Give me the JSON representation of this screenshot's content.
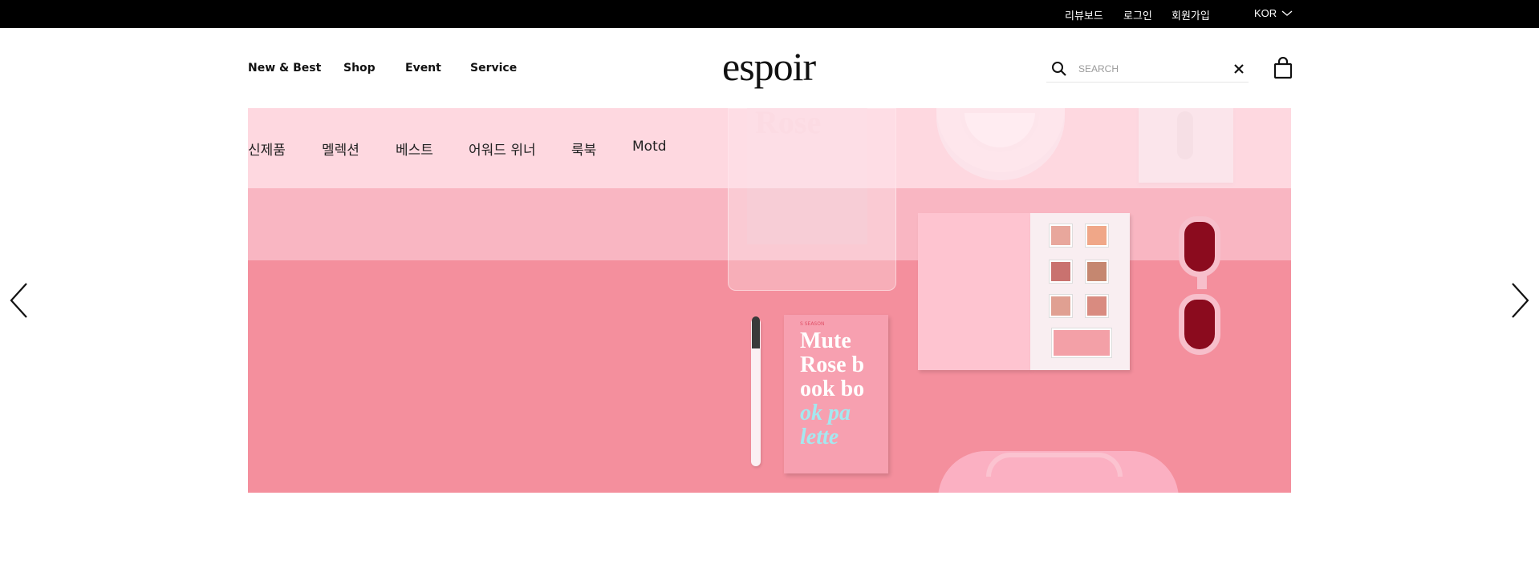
{
  "topbar": {
    "links": [
      "리뷰보드",
      "로그인",
      "회원가입"
    ],
    "language": "KOR"
  },
  "header": {
    "logo": "espoir",
    "nav": [
      "New & Best",
      "Shop",
      "Event",
      "Service"
    ],
    "search": {
      "placeholder": "SEARCH",
      "value": ""
    }
  },
  "hero": {
    "subnav": [
      "신제품",
      "멜렉션",
      "베스트",
      "어워드 위너",
      "룩북",
      "Motd"
    ],
    "book_lines": [
      "Mute",
      "Rose b",
      "ook bo",
      "ok pa",
      "lette"
    ],
    "book_season": "S SEASON"
  },
  "colors": {
    "topbar_bg": "#000000",
    "hero_pink": "#f48f9d"
  },
  "icons": [
    "search-icon",
    "close-icon",
    "shopping-bag-icon",
    "chevron-down-icon",
    "chevron-left-icon",
    "chevron-right-icon"
  ]
}
